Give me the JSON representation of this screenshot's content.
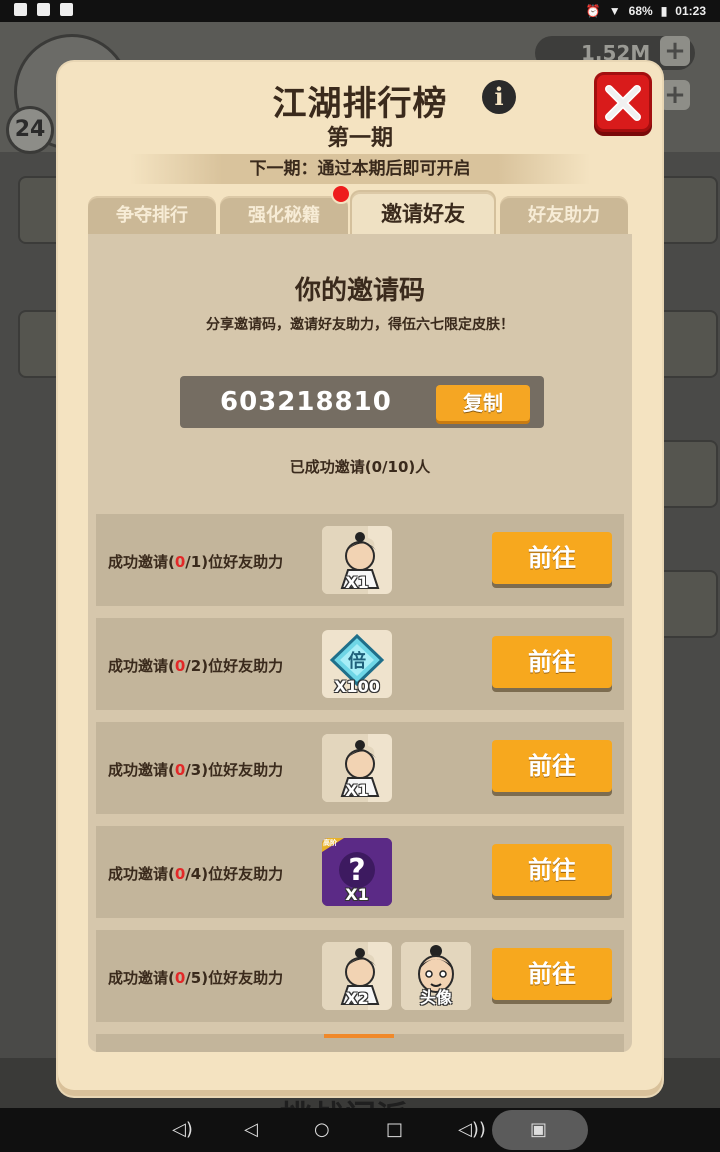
{
  "status_bar": {
    "battery": "68%",
    "time": "01:23"
  },
  "background": {
    "level": "24",
    "gold": "1.52M",
    "bottom_title": "挑战门派"
  },
  "dialog": {
    "title": "江湖排行榜",
    "subtitle": "第一期",
    "notice": "下一期：通过本期后即可开启",
    "tabs": [
      "争夺排行",
      "强化秘籍",
      "邀请好友",
      "好友助力"
    ],
    "active_tab": "邀请好友",
    "code_heading": "你的邀请码",
    "code_desc": "分享邀请码，邀请好友助力，得伍六七限定皮肤！",
    "invite_code": "603218810",
    "copy_label": "复制",
    "invited_count": "已成功邀请(0/10)人",
    "rows": [
      {
        "prefix": "成功邀请(",
        "done": "0",
        "suffix": "/1)位好友助力",
        "rewards": [
          {
            "icon": "character-fragment-icon",
            "qty": "X1"
          }
        ],
        "button": "前往"
      },
      {
        "prefix": "成功邀请(",
        "done": "0",
        "suffix": "/2)位好友助力",
        "rewards": [
          {
            "icon": "multiplier-gem-icon",
            "qty": "X100"
          }
        ],
        "button": "前往"
      },
      {
        "prefix": "成功邀请(",
        "done": "0",
        "suffix": "/3)位好友助力",
        "rewards": [
          {
            "icon": "character-fragment-icon",
            "qty": "X1"
          }
        ],
        "button": "前往"
      },
      {
        "prefix": "成功邀请(",
        "done": "0",
        "suffix": "/4)位好友助力",
        "rewards": [
          {
            "icon": "mystery-box-icon",
            "qty": "X1",
            "badge": "高阶"
          }
        ],
        "button": "前往"
      },
      {
        "prefix": "成功邀请(",
        "done": "0",
        "suffix": "/5)位好友助力",
        "rewards": [
          {
            "icon": "character-fragment-icon",
            "qty": "X2"
          },
          {
            "icon": "avatar-icon",
            "qty": "头像"
          }
        ],
        "button": "前往"
      }
    ]
  },
  "colors": {
    "accent": "#f7a81e",
    "close": "#d91b1b",
    "panel": "#d6c7ac",
    "dialog": "#f4e3c1"
  }
}
